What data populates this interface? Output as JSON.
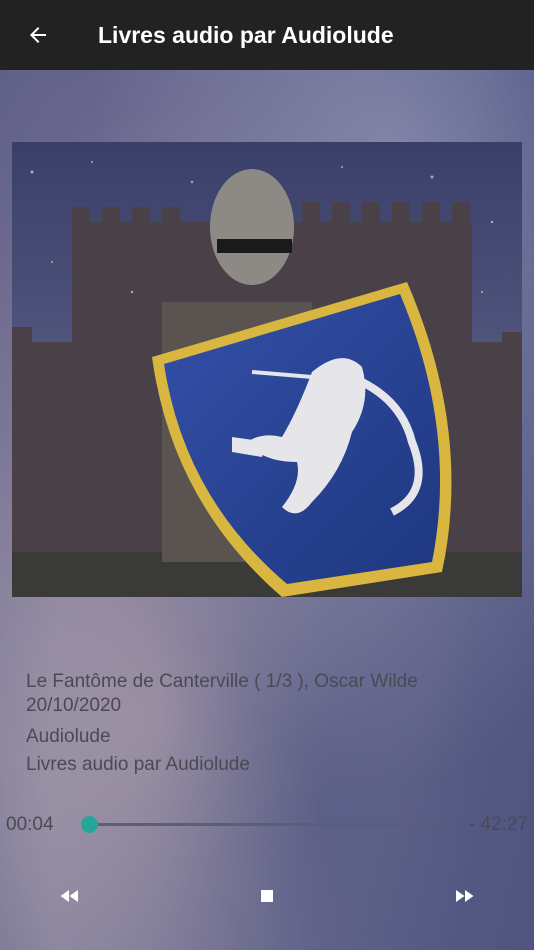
{
  "appbar": {
    "title": "Livres audio par Audiolude",
    "back_icon": "arrow-left-icon"
  },
  "episode": {
    "title": "Le Fantôme de Canterville ( 1/3 ), Oscar Wilde",
    "date": "20/10/2020",
    "author": "Audiolude",
    "podcast": "Livres audio par Audiolude"
  },
  "player": {
    "elapsed": "00:04",
    "remaining": "- 42:27",
    "progress_fraction": 0.0016,
    "controls": [
      "rewind-icon",
      "stop-icon",
      "fast-forward-icon"
    ]
  },
  "colors": {
    "appbar": "#222222",
    "accent": "#26a69a",
    "text": "#4a4a55"
  }
}
